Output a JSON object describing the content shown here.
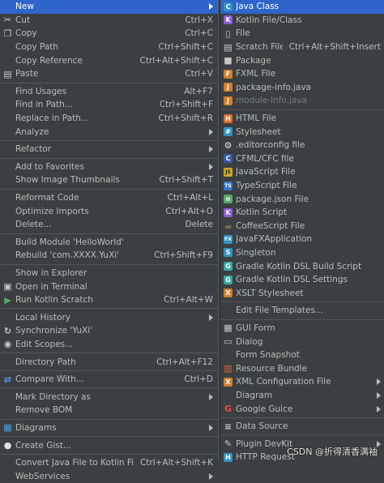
{
  "main_menu": {
    "groups": [
      [
        {
          "id": "new",
          "label": "New",
          "shortcut": "",
          "submenu": true,
          "selected": true,
          "icon": ""
        },
        {
          "id": "cut",
          "label": "Cut",
          "shortcut": "Ctrl+X",
          "icon": "scissors-icon"
        },
        {
          "id": "copy",
          "label": "Copy",
          "shortcut": "Ctrl+C",
          "icon": "copy-icon"
        },
        {
          "id": "copy-path",
          "label": "Copy Path",
          "shortcut": "Ctrl+Shift+C",
          "icon": ""
        },
        {
          "id": "copy-reference",
          "label": "Copy Reference",
          "shortcut": "Ctrl+Alt+Shift+C",
          "icon": ""
        },
        {
          "id": "paste",
          "label": "Paste",
          "shortcut": "Ctrl+V",
          "icon": "paste-icon"
        }
      ],
      [
        {
          "id": "find-usages",
          "label": "Find Usages",
          "shortcut": "Alt+F7",
          "icon": ""
        },
        {
          "id": "find-in-path",
          "label": "Find in Path...",
          "shortcut": "Ctrl+Shift+F",
          "icon": ""
        },
        {
          "id": "replace-in-path",
          "label": "Replace in Path...",
          "shortcut": "Ctrl+Shift+R",
          "icon": ""
        },
        {
          "id": "analyze",
          "label": "Analyze",
          "shortcut": "",
          "submenu": true,
          "icon": ""
        }
      ],
      [
        {
          "id": "refactor",
          "label": "Refactor",
          "shortcut": "",
          "submenu": true,
          "icon": ""
        }
      ],
      [
        {
          "id": "add-to-favorites",
          "label": "Add to Favorites",
          "shortcut": "",
          "submenu": true,
          "icon": ""
        },
        {
          "id": "show-image-thumbnails",
          "label": "Show Image Thumbnails",
          "shortcut": "Ctrl+Shift+T",
          "icon": ""
        }
      ],
      [
        {
          "id": "reformat-code",
          "label": "Reformat Code",
          "shortcut": "Ctrl+Alt+L",
          "icon": ""
        },
        {
          "id": "optimize-imports",
          "label": "Optimize Imports",
          "shortcut": "Ctrl+Alt+O",
          "icon": ""
        },
        {
          "id": "delete",
          "label": "Delete...",
          "shortcut": "Delete",
          "icon": ""
        }
      ],
      [
        {
          "id": "build-module",
          "label": "Build Module 'HelloWorld'",
          "shortcut": "",
          "icon": ""
        },
        {
          "id": "rebuild",
          "label": "Rebuild 'com.XXXX.YuXi'",
          "shortcut": "Ctrl+Shift+F9",
          "icon": ""
        }
      ],
      [
        {
          "id": "show-in-explorer",
          "label": "Show in Explorer",
          "shortcut": "",
          "icon": ""
        },
        {
          "id": "open-in-terminal",
          "label": "Open in Terminal",
          "shortcut": "",
          "icon": "terminal-icon"
        },
        {
          "id": "run-kotlin-scratch",
          "label": "Run Kotlin Scratch",
          "shortcut": "Ctrl+Alt+W",
          "icon": "run-icon"
        }
      ],
      [
        {
          "id": "local-history",
          "label": "Local History",
          "shortcut": "",
          "submenu": true,
          "icon": ""
        },
        {
          "id": "synchronize",
          "label": "Synchronize 'YuXi'",
          "shortcut": "",
          "icon": "sync-icon"
        },
        {
          "id": "edit-scopes",
          "label": "Edit Scopes...",
          "shortcut": "",
          "icon": "scope-icon"
        }
      ],
      [
        {
          "id": "directory-path",
          "label": "Directory Path",
          "shortcut": "Ctrl+Alt+F12",
          "icon": ""
        }
      ],
      [
        {
          "id": "compare-with",
          "label": "Compare With...",
          "shortcut": "Ctrl+D",
          "icon": "compare-icon"
        }
      ],
      [
        {
          "id": "mark-directory-as",
          "label": "Mark Directory as",
          "shortcut": "",
          "submenu": true,
          "icon": ""
        },
        {
          "id": "remove-bom",
          "label": "Remove BOM",
          "shortcut": "",
          "icon": ""
        }
      ],
      [
        {
          "id": "diagrams",
          "label": "Diagrams",
          "shortcut": "",
          "submenu": true,
          "icon": "diagram-icon"
        }
      ],
      [
        {
          "id": "create-gist",
          "label": "Create Gist...",
          "shortcut": "",
          "icon": "github-icon"
        }
      ],
      [
        {
          "id": "convert-java-to-kotlin",
          "label": "Convert Java File to Kotlin File",
          "shortcut": "Ctrl+Alt+Shift+K",
          "icon": ""
        },
        {
          "id": "webservices",
          "label": "WebServices",
          "shortcut": "",
          "submenu": true,
          "icon": ""
        }
      ]
    ]
  },
  "sub_menu": {
    "groups": [
      [
        {
          "id": "java-class",
          "label": "Java Class",
          "shortcut": "",
          "selected": true,
          "icon": "java-class-icon"
        },
        {
          "id": "kotlin-file-class",
          "label": "Kotlin File/Class",
          "shortcut": "",
          "icon": "kotlin-icon"
        },
        {
          "id": "file",
          "label": "File",
          "shortcut": "",
          "icon": "file-icon"
        },
        {
          "id": "scratch-file",
          "label": "Scratch File",
          "shortcut": "Ctrl+Alt+Shift+Insert",
          "icon": "scratch-file-icon"
        },
        {
          "id": "package",
          "label": "Package",
          "shortcut": "",
          "icon": "package-icon"
        },
        {
          "id": "fxml-file",
          "label": "FXML File",
          "shortcut": "",
          "icon": "fxml-icon"
        },
        {
          "id": "package-info-java",
          "label": "package-info.java",
          "shortcut": "",
          "icon": "java-file-icon"
        },
        {
          "id": "module-info-java",
          "label": "module-info.java",
          "shortcut": "",
          "disabled": true,
          "icon": "java-file-icon"
        }
      ],
      [
        {
          "id": "html-file",
          "label": "HTML File",
          "shortcut": "",
          "icon": "html-icon"
        },
        {
          "id": "stylesheet",
          "label": "Stylesheet",
          "shortcut": "",
          "icon": "css-icon"
        },
        {
          "id": "editorconfig-file",
          "label": ".editorconfig file",
          "shortcut": "",
          "icon": "editorconfig-icon"
        },
        {
          "id": "cfml-cfc-file",
          "label": "CFML/CFC file",
          "shortcut": "",
          "icon": "cfml-icon"
        },
        {
          "id": "javascript-file",
          "label": "JavaScript File",
          "shortcut": "",
          "icon": "javascript-icon"
        },
        {
          "id": "typescript-file",
          "label": "TypeScript File",
          "shortcut": "",
          "icon": "typescript-icon"
        },
        {
          "id": "package-json-file",
          "label": "package.json File",
          "shortcut": "",
          "icon": "npm-icon"
        },
        {
          "id": "kotlin-script",
          "label": "Kotlin Script",
          "shortcut": "",
          "icon": "kotlin-icon"
        },
        {
          "id": "coffeescript-file",
          "label": "CoffeeScript File",
          "shortcut": "",
          "icon": "coffeescript-icon"
        },
        {
          "id": "javafx-application",
          "label": "JavaFXApplication",
          "shortcut": "",
          "icon": "javafx-icon"
        },
        {
          "id": "singleton",
          "label": "Singleton",
          "shortcut": "",
          "icon": "singleton-icon"
        },
        {
          "id": "gradle-kotlin-dsl-build-script",
          "label": "Gradle Kotlin DSL Build Script",
          "shortcut": "",
          "icon": "gradle-icon"
        },
        {
          "id": "gradle-kotlin-dsl-settings",
          "label": "Gradle Kotlin DSL Settings",
          "shortcut": "",
          "icon": "gradle-icon"
        },
        {
          "id": "xslt-stylesheet",
          "label": "XSLT Stylesheet",
          "shortcut": "",
          "icon": "xslt-icon"
        }
      ],
      [
        {
          "id": "edit-file-templates",
          "label": "Edit File Templates...",
          "shortcut": "",
          "icon": ""
        }
      ],
      [
        {
          "id": "gui-form",
          "label": "GUI Form",
          "shortcut": "",
          "icon": "gui-form-icon"
        },
        {
          "id": "dialog",
          "label": "Dialog",
          "shortcut": "",
          "icon": "dialog-icon"
        },
        {
          "id": "form-snapshot",
          "label": "Form Snapshot",
          "shortcut": "",
          "icon": ""
        },
        {
          "id": "resource-bundle",
          "label": "Resource Bundle",
          "shortcut": "",
          "icon": "resource-bundle-icon"
        },
        {
          "id": "xml-configuration-file",
          "label": "XML Configuration File",
          "shortcut": "",
          "submenu": true,
          "icon": "xml-icon"
        },
        {
          "id": "diagram",
          "label": "Diagram",
          "shortcut": "",
          "submenu": true,
          "icon": ""
        },
        {
          "id": "google-guice",
          "label": "Google Guice",
          "shortcut": "",
          "submenu": true,
          "icon": "google-icon"
        }
      ],
      [
        {
          "id": "data-source",
          "label": "Data Source",
          "shortcut": "",
          "icon": "database-icon"
        }
      ],
      [
        {
          "id": "plugin-devkit",
          "label": "Plugin DevKit",
          "shortcut": "",
          "submenu": true,
          "icon": "plugin-icon"
        },
        {
          "id": "http-request",
          "label": "HTTP Request",
          "shortcut": "",
          "icon": "http-icon"
        }
      ]
    ]
  },
  "watermark": "CSDN @折得清香满袖",
  "colors": {
    "menu_bg": "#3c3f41",
    "selection": "#2f65ca",
    "text": "#bbbbbb",
    "separator": "#515658"
  },
  "icon_styles": {
    "scissors-icon": {
      "glyph": "✂",
      "bg": "transparent",
      "fg": "#c9c9c9"
    },
    "copy-icon": {
      "glyph": "❐",
      "bg": "transparent",
      "fg": "#c9c9c9"
    },
    "paste-icon": {
      "glyph": "▤",
      "bg": "transparent",
      "fg": "#c9c9c9"
    },
    "terminal-icon": {
      "glyph": "▣",
      "bg": "transparent",
      "fg": "#c9c9c9"
    },
    "run-icon": {
      "glyph": "▶",
      "bg": "transparent",
      "fg": "#59a869"
    },
    "sync-icon": {
      "glyph": "↻",
      "bg": "transparent",
      "fg": "#c9c9c9"
    },
    "scope-icon": {
      "glyph": "◉",
      "bg": "transparent",
      "fg": "#c9c9c9"
    },
    "compare-icon": {
      "glyph": "⇄",
      "bg": "transparent",
      "fg": "#4a9ee8"
    },
    "diagram-icon": {
      "glyph": "▦",
      "bg": "transparent",
      "fg": "#4a9ee8"
    },
    "github-icon": {
      "glyph": "●",
      "bg": "transparent",
      "fg": "#e0e0e0"
    },
    "java-class-icon": {
      "glyph": "C",
      "bg": "#3592c4",
      "fg": "#ffffff"
    },
    "kotlin-icon": {
      "glyph": "K",
      "bg": "#8e5dd6",
      "fg": "#ffffff"
    },
    "file-icon": {
      "glyph": "▯",
      "bg": "transparent",
      "fg": "#c9c9c9"
    },
    "scratch-file-icon": {
      "glyph": "▤",
      "bg": "transparent",
      "fg": "#c9c9c9"
    },
    "package-icon": {
      "glyph": "■",
      "bg": "transparent",
      "fg": "#c9c9c9"
    },
    "fxml-icon": {
      "glyph": "F",
      "bg": "#d07f2c",
      "fg": "#ffffff"
    },
    "java-file-icon": {
      "glyph": "J",
      "bg": "#d07f2c",
      "fg": "#ffffff"
    },
    "html-icon": {
      "glyph": "H",
      "bg": "#e06c2a",
      "fg": "#ffffff"
    },
    "css-icon": {
      "glyph": "#",
      "bg": "#3592c4",
      "fg": "#ffffff"
    },
    "editorconfig-icon": {
      "glyph": "⚙",
      "bg": "transparent",
      "fg": "#e0e0e0"
    },
    "cfml-icon": {
      "glyph": "C",
      "bg": "#3b5ba8",
      "fg": "#ffffff"
    },
    "javascript-icon": {
      "glyph": "JS",
      "bg": "#c9a825",
      "fg": "#2b2b2b"
    },
    "typescript-icon": {
      "glyph": "TS",
      "bg": "#3178c6",
      "fg": "#ffffff"
    },
    "npm-icon": {
      "glyph": "n",
      "bg": "#59a869",
      "fg": "#ffffff"
    },
    "coffeescript-icon": {
      "glyph": "☕",
      "bg": "transparent",
      "fg": "#c9a060"
    },
    "javafx-icon": {
      "glyph": "FX",
      "bg": "#3592c4",
      "fg": "#ffffff"
    },
    "singleton-icon": {
      "glyph": "S",
      "bg": "#3592c4",
      "fg": "#ffffff"
    },
    "gradle-icon": {
      "glyph": "G",
      "bg": "#3aa8a0",
      "fg": "#ffffff"
    },
    "xslt-icon": {
      "glyph": "X",
      "bg": "#d07f2c",
      "fg": "#ffffff"
    },
    "gui-form-icon": {
      "glyph": "▦",
      "bg": "transparent",
      "fg": "#c9c9c9"
    },
    "dialog-icon": {
      "glyph": "▭",
      "bg": "transparent",
      "fg": "#c9c9c9"
    },
    "resource-bundle-icon": {
      "glyph": "▥",
      "bg": "transparent",
      "fg": "#e06c2a"
    },
    "xml-icon": {
      "glyph": "X",
      "bg": "#d07f2c",
      "fg": "#ffffff"
    },
    "google-icon": {
      "glyph": "G",
      "bg": "transparent",
      "fg": "#e44d3a"
    },
    "database-icon": {
      "glyph": "≡",
      "bg": "transparent",
      "fg": "#c9c9c9"
    },
    "plugin-icon": {
      "glyph": "✎",
      "bg": "transparent",
      "fg": "#c9c9c9"
    },
    "http-icon": {
      "glyph": "H",
      "bg": "#3592c4",
      "fg": "#ffffff"
    }
  }
}
